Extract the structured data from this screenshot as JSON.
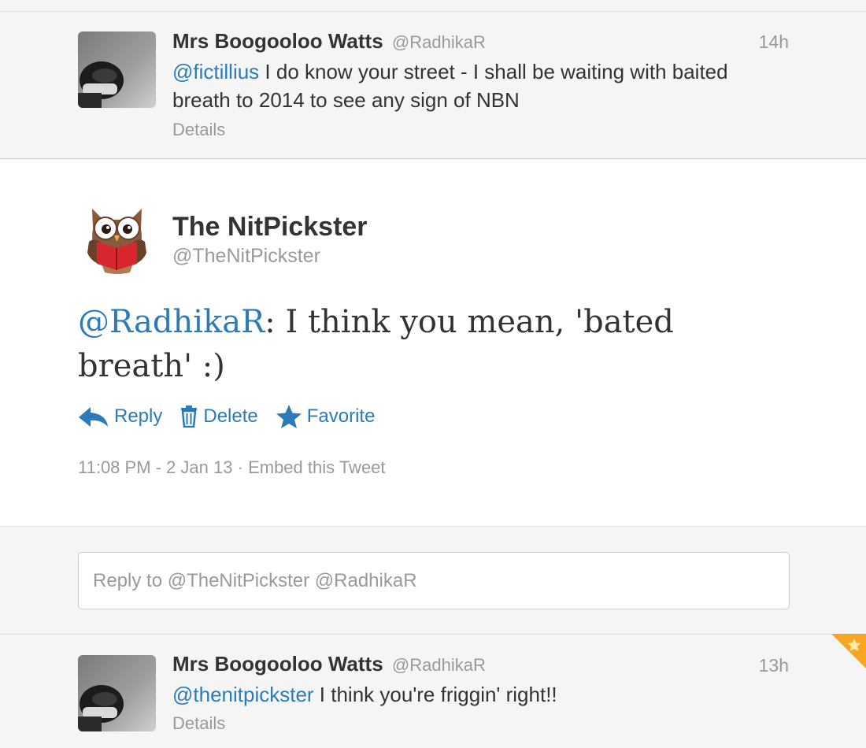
{
  "tweet_prev": {
    "name": "Mrs Boogooloo Watts",
    "handle": "@RadhikaR",
    "time": "14h",
    "mention": "@fictillius",
    "text": " I do know your street - I shall be waiting with baited breath to 2014 to see any sign of NBN",
    "details": "Details"
  },
  "main_tweet": {
    "name": "The NitPickster",
    "handle": "@TheNitPickster",
    "mention": "@RadhikaR",
    "text": ": I think you mean, 'bated breath' :)",
    "actions": {
      "reply": "Reply",
      "delete": "Delete",
      "favorite": "Favorite"
    },
    "timestamp": "11:08 PM - 2 Jan 13",
    "separator": " · ",
    "embed": "Embed this Tweet"
  },
  "reply": {
    "placeholder": "Reply to @TheNitPickster @RadhikaR"
  },
  "tweet_next": {
    "name": "Mrs Boogooloo Watts",
    "handle": "@RadhikaR",
    "time": "13h",
    "mention": "@thenitpickster",
    "text": " I think you're friggin' right!!",
    "details": "Details"
  },
  "colors": {
    "link": "#2b7bb9",
    "muted": "#999999",
    "text": "#333333",
    "favorite_corner": "#f5a623"
  }
}
